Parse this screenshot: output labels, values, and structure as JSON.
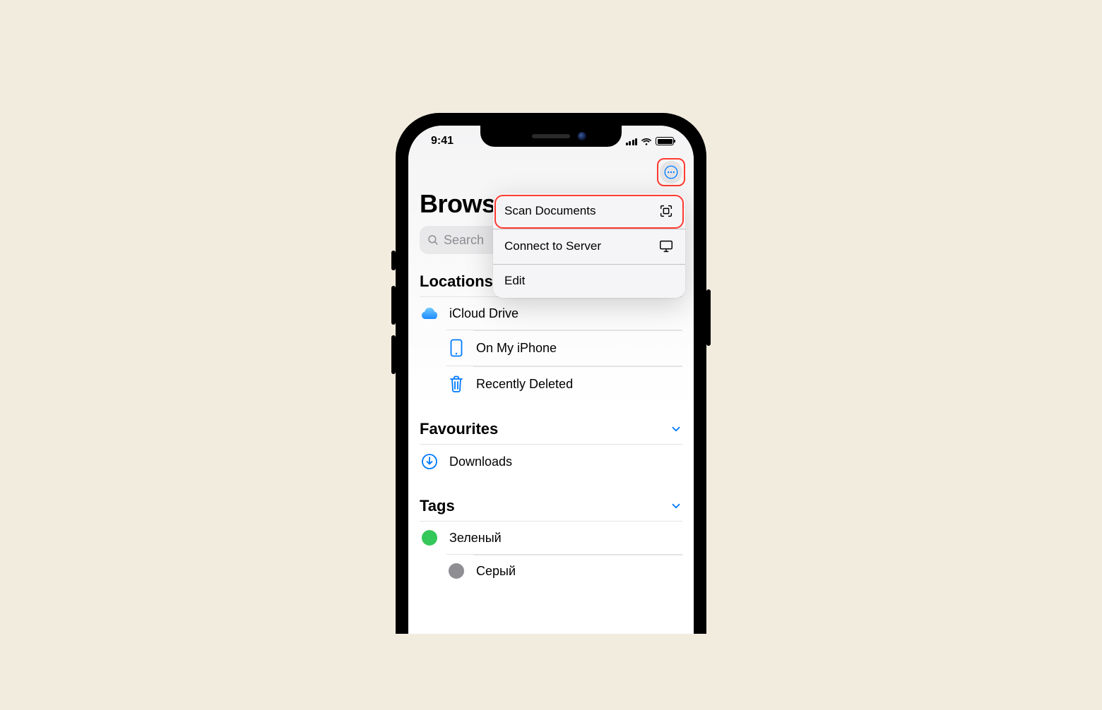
{
  "status": {
    "time": "9:41"
  },
  "page": {
    "title": "Browse"
  },
  "search": {
    "placeholder": "Search"
  },
  "menu": {
    "scan": "Scan Documents",
    "connect": "Connect to Server",
    "edit": "Edit"
  },
  "sections": {
    "locations": {
      "header": "Locations",
      "items": {
        "icloud": "iCloud Drive",
        "onmyiphone": "On My iPhone",
        "recentlydeleted": "Recently Deleted"
      }
    },
    "favourites": {
      "header": "Favourites",
      "items": {
        "downloads": "Downloads"
      }
    },
    "tags": {
      "header": "Tags",
      "items": {
        "green": "Зеленый",
        "grey": "Серый"
      }
    }
  },
  "colors": {
    "accent": "#007aff",
    "green": "#34c759",
    "grey": "#8e8e93",
    "highlight": "#ff3b30"
  }
}
